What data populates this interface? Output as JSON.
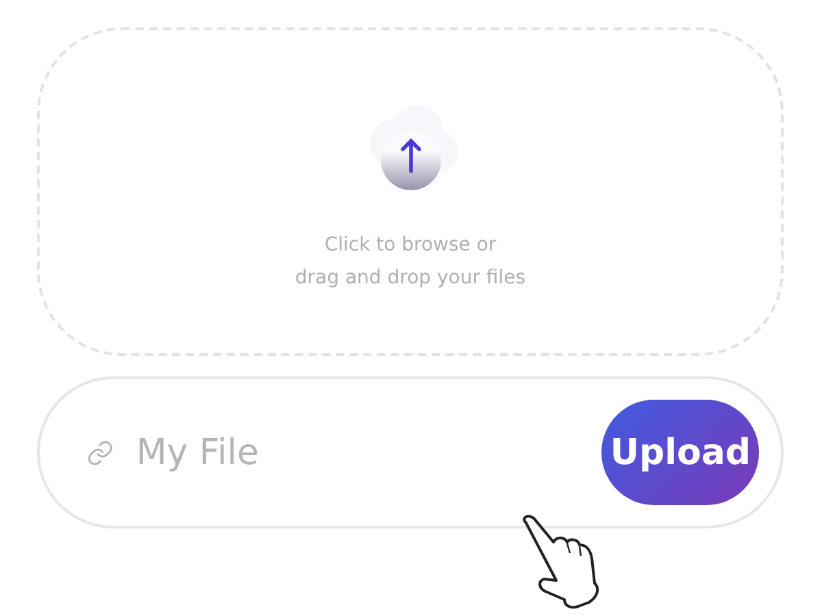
{
  "dropzone": {
    "hint": "Click to browse or\ndrag and drop your files"
  },
  "file_field": {
    "placeholder": "My File"
  },
  "upload_button": {
    "label": "Upload"
  }
}
